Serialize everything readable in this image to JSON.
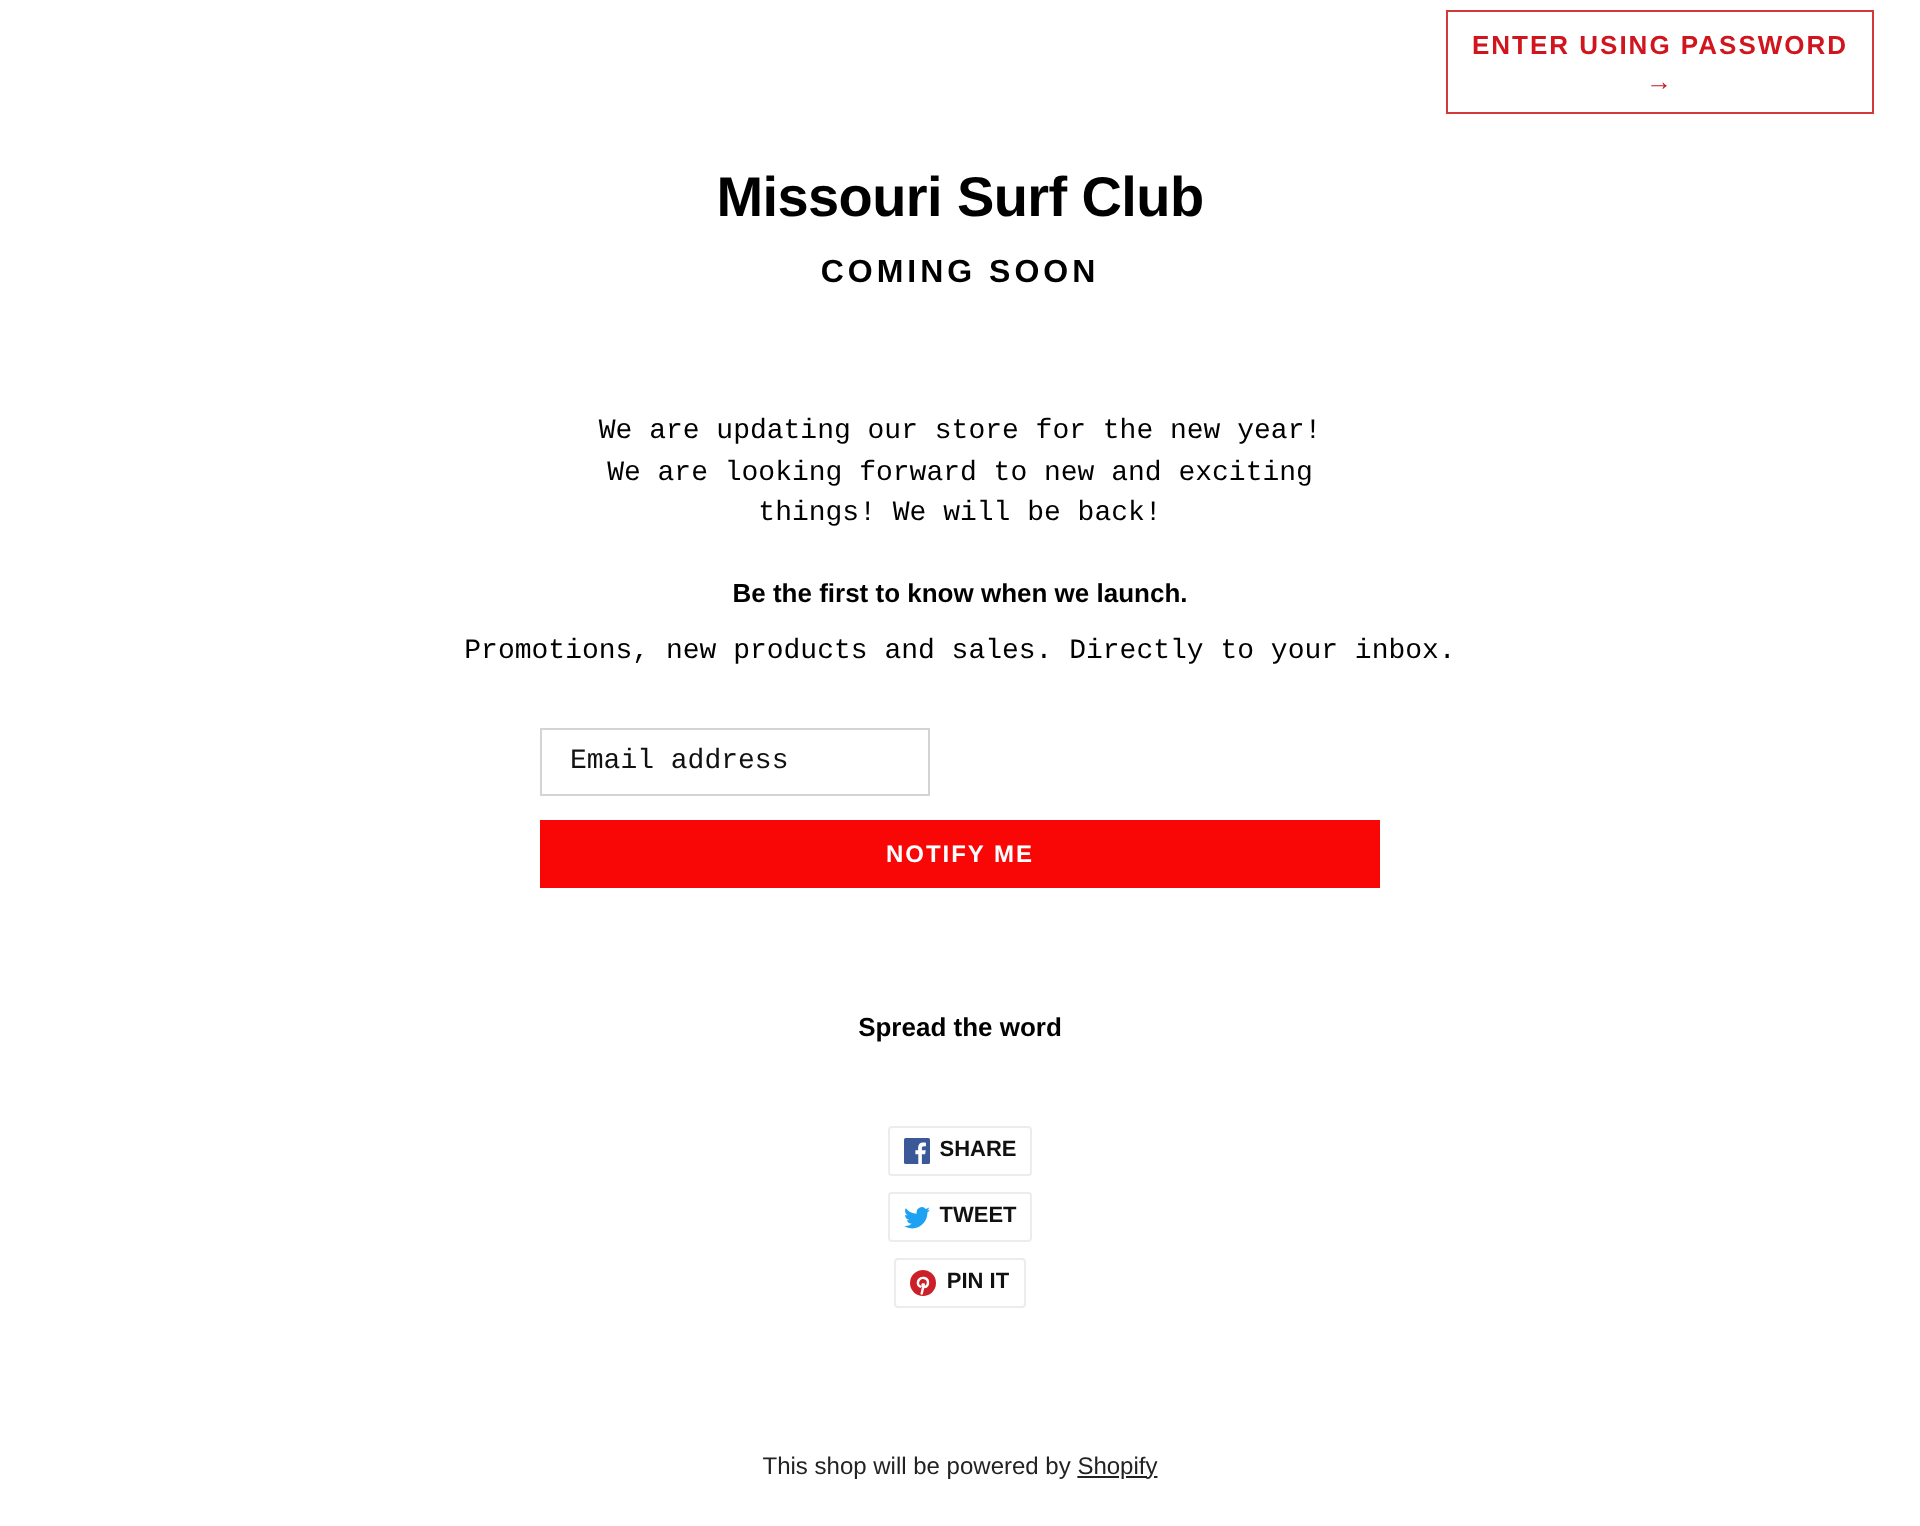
{
  "header": {
    "password_button": {
      "label": "ENTER USING PASSWORD",
      "arrow": "→"
    }
  },
  "hero": {
    "title": "Missouri Surf Club",
    "subtitle": "COMING SOON"
  },
  "message": "We are updating our store for the new year! We are looking forward to new and exciting things! We will be back!",
  "signup": {
    "heading": "Be the first to know when we launch.",
    "text": "Promotions, new products and sales. Directly to your inbox.",
    "email": {
      "placeholder": "Email address"
    },
    "button": "NOTIFY ME"
  },
  "share": {
    "heading": "Spread the word",
    "buttons": [
      {
        "kind": "facebook",
        "label": "SHARE"
      },
      {
        "kind": "twitter",
        "label": "TWEET"
      },
      {
        "kind": "pinterest",
        "label": "PIN IT"
      }
    ]
  },
  "footer": {
    "text": "This shop will be powered by",
    "link": "Shopify"
  }
}
